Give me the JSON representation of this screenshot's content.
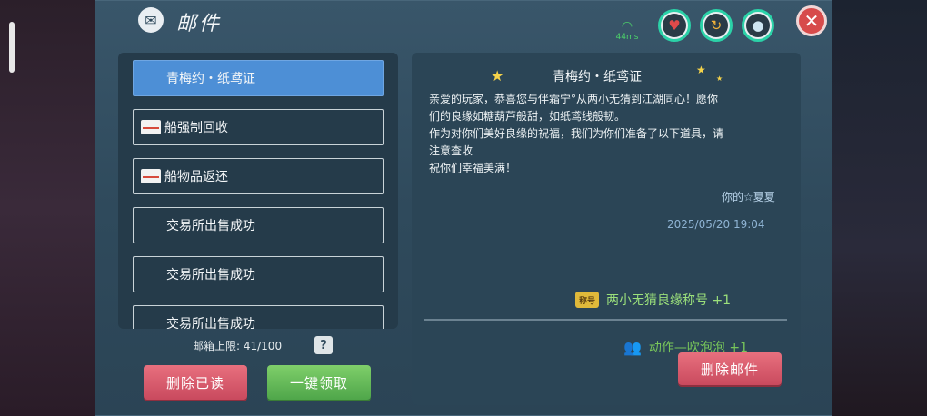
{
  "header": {
    "title": "邮件"
  },
  "status": {
    "ping": "44ms"
  },
  "mail_list": {
    "items": [
      {
        "label": "青梅约・纸鸢证",
        "has_icon": false,
        "active": true
      },
      {
        "label": "船强制回收",
        "has_icon": true,
        "active": false
      },
      {
        "label": "船物品返还",
        "has_icon": true,
        "active": false
      },
      {
        "label": "交易所出售成功",
        "has_icon": false,
        "active": false
      },
      {
        "label": "交易所出售成功",
        "has_icon": false,
        "active": false
      },
      {
        "label": "交易所出售成功",
        "has_icon": false,
        "active": false
      }
    ],
    "capacity": "邮箱上限: 41/100",
    "help": "?"
  },
  "buttons": {
    "delete_read": "删除已读",
    "claim_all": "一键领取",
    "delete_mail": "删除邮件"
  },
  "detail": {
    "title": "青梅约・纸鸢证",
    "body": [
      "亲爱的玩家，恭喜您与伴霜宁°从两小无猜到江湖同心！愿你",
      "们的良缘如糖葫芦般甜，如纸鸢线般韧。",
      "作为对你们美好良缘的祝福，我们为你们准备了以下道具，请",
      "注意查收",
      "祝你们幸福美满！"
    ],
    "signature": "你的☆夏夏",
    "date": "2025/05/20 19:04",
    "rewards": [
      {
        "icon": "称号",
        "text": "两小无猜良缘称号 +1"
      },
      {
        "text": "动作—吹泡泡 +1"
      }
    ]
  },
  "colors": {
    "accent_blue": "#4d8fd6",
    "reward_green": "#9be07b",
    "close_red": "#d74b4b"
  }
}
